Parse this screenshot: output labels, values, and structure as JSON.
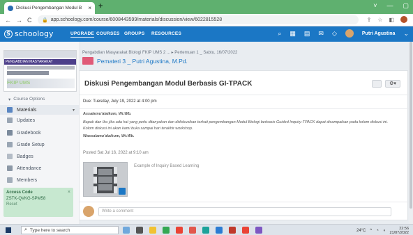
{
  "browser": {
    "tab_title": "Diskusi Pengembangan Modul B",
    "tab_close": "×",
    "new_tab": "+",
    "url": "app.schoology.com/course/6008443599/materials/discussion/view/6022815528",
    "window_controls": [
      "˅",
      "—",
      "▢"
    ]
  },
  "header": {
    "logo_text": "schoology",
    "nav": {
      "upgrade": "UPGRADE",
      "courses": "COURSES",
      "groups": "GROUPS",
      "resources": "RESOURCES"
    },
    "user_name": "Putri Agustina",
    "icons": [
      "search-icon",
      "apps-grid-icon",
      "calendar-icon",
      "mail-icon",
      "notification-icon"
    ]
  },
  "sidebar": {
    "banner_text": "PENGABDIAN MASYARAKAT",
    "banner_overlay": "FKIP UMS",
    "course_options": "Course Options",
    "items": [
      {
        "label": "Materials"
      },
      {
        "label": "Updates"
      },
      {
        "label": "Gradebook"
      },
      {
        "label": "Grade Setup"
      },
      {
        "label": "Badges"
      },
      {
        "label": "Attendance"
      },
      {
        "label": "Members"
      }
    ],
    "access_code": {
      "title": "Access Code",
      "code": "ZSTK-QVKG-SPM58",
      "reset": "Reset",
      "close": "×"
    }
  },
  "main": {
    "breadcrumb": "Pengabdian Masyarakat Biologi FKIP UMS 2 ... ▸ Pertemuan 1 _ Sabtu, 16/07/2022",
    "section_title": "Pemateri 3 _ Putri Agustina, M.Pd.",
    "discussion_title": "Diskusi Pengembangan Modul Berbasis GI-TPACK",
    "gear_label": "⚙▾",
    "due": "Due: Tuesday, July 19, 2022 at 4:00 pm",
    "greeting": "Assalamu'alaikum, Wr.Wb.",
    "body_line1": "Bapak dan Ibu jika ada hal yang perlu ditanyakan dan didiskusikan terkait pengembangan Modul Biologi berbasis Guided Inquiry-TPACK dapat disampaikan pada kolom diskusi ini.",
    "body_line2": "Kolom diskusi ini akan kami buka sampai hari terakhir workshop.",
    "closing": "Wassalamu'alaikum, Wr.Wb.",
    "posted": "Posted Sat Jul 16, 2022 at 9:10 am",
    "attachment_label": "Example of Inquiry Based Learning",
    "comment_placeholder": "Write a comment"
  },
  "taskbar": {
    "search_placeholder": "Type here to search",
    "weather": "24°C",
    "time": "22:56",
    "date": "21/07/2022"
  }
}
